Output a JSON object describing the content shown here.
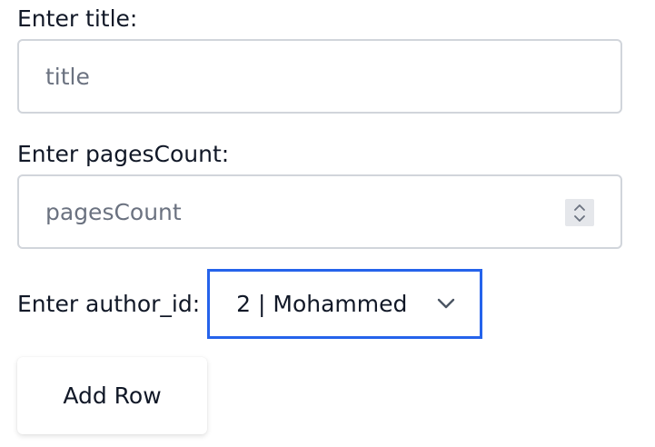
{
  "form": {
    "title_label": "Enter title:",
    "title_placeholder": "title",
    "pages_label": "Enter pagesCount:",
    "pages_placeholder": "pagesCount",
    "author_label": "Enter author_id:",
    "author_selected": "2 | Mohammed",
    "add_button_label": "Add Row"
  },
  "icons": {
    "spinner": "number-spinner-icon",
    "dropdown": "chevron-down-icon"
  },
  "colors": {
    "focus_border": "#2563eb",
    "input_border": "#d1d5db",
    "placeholder": "#6b7280"
  }
}
